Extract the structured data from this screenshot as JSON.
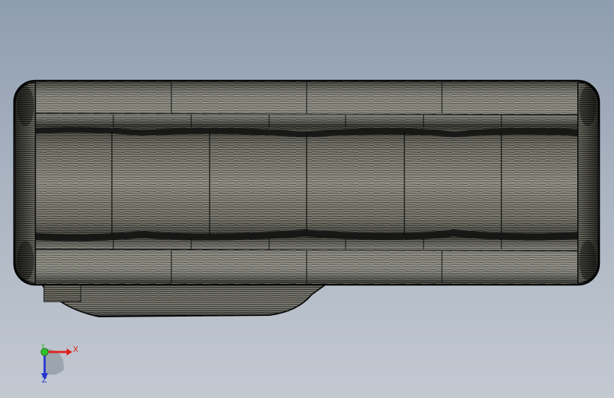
{
  "triad": {
    "x_label": "X",
    "y_label": "Y",
    "z_label": "Z",
    "colors": {
      "x": "#e0211c",
      "y": "#2fc02a",
      "z": "#2534d0"
    }
  },
  "model": {
    "icon": "roller-part-mesh-icon",
    "render_style": "wireframe-shaded",
    "face_color": "#b9b8a8",
    "edge_color": "#0c0c0c"
  }
}
